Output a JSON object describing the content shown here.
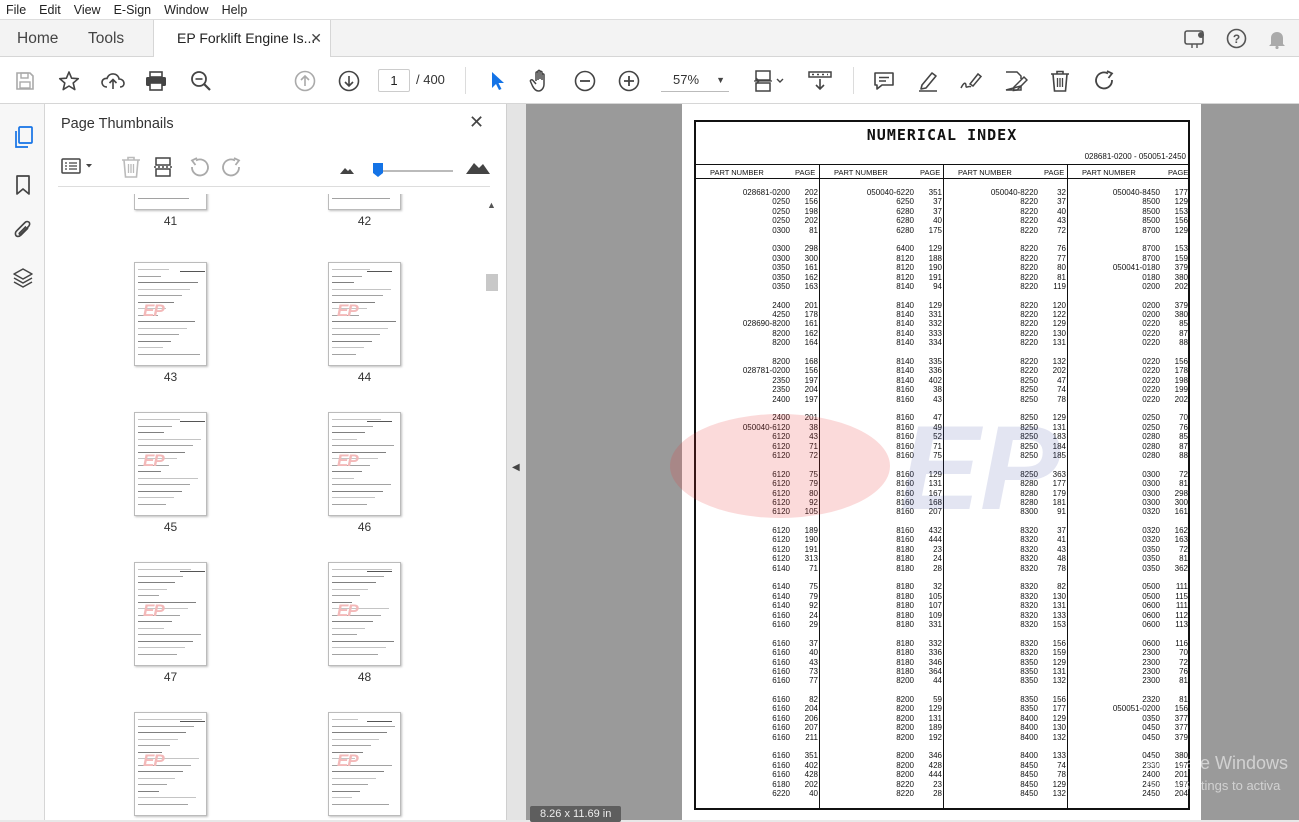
{
  "menu": [
    "File",
    "Edit",
    "View",
    "E-Sign",
    "Window",
    "Help"
  ],
  "tabs": {
    "home": "Home",
    "tools": "Tools",
    "document": "EP Forklift Engine Is..."
  },
  "toolbar": {
    "page_current": "1",
    "page_total": "/  400",
    "zoom": "57%"
  },
  "panel": {
    "title": "Page Thumbnails",
    "thumb_watermark": "EP",
    "thumbs": [
      "41",
      "42",
      "43",
      "44",
      "45",
      "46",
      "47",
      "48"
    ]
  },
  "page": {
    "title": "NUMERICAL  INDEX",
    "range": "028681-0200 - 050051-2450",
    "col_headers": {
      "part": "PART NUMBER",
      "page": "PAGE"
    },
    "col1": [
      [
        "028681-0200",
        "202"
      ],
      [
        "0250",
        "156"
      ],
      [
        "0250",
        "198"
      ],
      [
        "0250",
        "202"
      ],
      [
        "0300",
        "81"
      ],
      null,
      [
        "0300",
        "298"
      ],
      [
        "0300",
        "300"
      ],
      [
        "0350",
        "161"
      ],
      [
        "0350",
        "162"
      ],
      [
        "0350",
        "163"
      ],
      null,
      [
        "2400",
        "201"
      ],
      [
        "4250",
        "178"
      ],
      [
        "028690-8200",
        "161"
      ],
      [
        "8200",
        "162"
      ],
      [
        "8200",
        "164"
      ],
      null,
      [
        "8200",
        "168"
      ],
      [
        "028781-0200",
        "156"
      ],
      [
        "2350",
        "197"
      ],
      [
        "2350",
        "204"
      ],
      [
        "2400",
        "197"
      ],
      null,
      [
        "2400",
        "201"
      ],
      [
        "050040-6120",
        "38"
      ],
      [
        "6120",
        "43"
      ],
      [
        "6120",
        "71"
      ],
      [
        "6120",
        "72"
      ],
      null,
      [
        "6120",
        "75"
      ],
      [
        "6120",
        "79"
      ],
      [
        "6120",
        "80"
      ],
      [
        "6120",
        "92"
      ],
      [
        "6120",
        "105"
      ],
      null,
      [
        "6120",
        "189"
      ],
      [
        "6120",
        "190"
      ],
      [
        "6120",
        "191"
      ],
      [
        "6120",
        "313"
      ],
      [
        "6140",
        "71"
      ],
      null,
      [
        "6140",
        "75"
      ],
      [
        "6140",
        "79"
      ],
      [
        "6140",
        "92"
      ],
      [
        "6160",
        "24"
      ],
      [
        "6160",
        "29"
      ],
      null,
      [
        "6160",
        "37"
      ],
      [
        "6160",
        "40"
      ],
      [
        "6160",
        "43"
      ],
      [
        "6160",
        "73"
      ],
      [
        "6160",
        "77"
      ],
      null,
      [
        "6160",
        "82"
      ],
      [
        "6160",
        "204"
      ],
      [
        "6160",
        "206"
      ],
      [
        "6160",
        "207"
      ],
      [
        "6160",
        "211"
      ],
      null,
      [
        "6160",
        "351"
      ],
      [
        "6160",
        "402"
      ],
      [
        "6160",
        "428"
      ],
      [
        "6180",
        "202"
      ],
      [
        "6220",
        "40"
      ]
    ],
    "col2": [
      [
        "050040-6220",
        "351"
      ],
      [
        "6250",
        "37"
      ],
      [
        "6280",
        "37"
      ],
      [
        "6280",
        "40"
      ],
      [
        "6280",
        "175"
      ],
      null,
      [
        "6400",
        "129"
      ],
      [
        "8120",
        "188"
      ],
      [
        "8120",
        "190"
      ],
      [
        "8120",
        "191"
      ],
      [
        "8140",
        "94"
      ],
      null,
      [
        "8140",
        "129"
      ],
      [
        "8140",
        "331"
      ],
      [
        "8140",
        "332"
      ],
      [
        "8140",
        "333"
      ],
      [
        "8140",
        "334"
      ],
      null,
      [
        "8140",
        "335"
      ],
      [
        "8140",
        "336"
      ],
      [
        "8140",
        "402"
      ],
      [
        "8160",
        "38"
      ],
      [
        "8160",
        "43"
      ],
      null,
      [
        "8160",
        "47"
      ],
      [
        "8160",
        "49"
      ],
      [
        "8160",
        "52"
      ],
      [
        "8160",
        "71"
      ],
      [
        "8160",
        "75"
      ],
      null,
      [
        "8160",
        "129"
      ],
      [
        "8160",
        "131"
      ],
      [
        "8160",
        "167"
      ],
      [
        "8160",
        "168"
      ],
      [
        "8160",
        "207"
      ],
      null,
      [
        "8160",
        "432"
      ],
      [
        "8160",
        "444"
      ],
      [
        "8180",
        "23"
      ],
      [
        "8180",
        "24"
      ],
      [
        "8180",
        "28"
      ],
      null,
      [
        "8180",
        "32"
      ],
      [
        "8180",
        "105"
      ],
      [
        "8180",
        "107"
      ],
      [
        "8180",
        "109"
      ],
      [
        "8180",
        "331"
      ],
      null,
      [
        "8180",
        "332"
      ],
      [
        "8180",
        "336"
      ],
      [
        "8180",
        "346"
      ],
      [
        "8180",
        "364"
      ],
      [
        "8200",
        "44"
      ],
      null,
      [
        "8200",
        "59"
      ],
      [
        "8200",
        "129"
      ],
      [
        "8200",
        "131"
      ],
      [
        "8200",
        "189"
      ],
      [
        "8200",
        "192"
      ],
      null,
      [
        "8200",
        "346"
      ],
      [
        "8200",
        "428"
      ],
      [
        "8200",
        "444"
      ],
      [
        "8220",
        "23"
      ],
      [
        "8220",
        "28"
      ]
    ],
    "col3": [
      [
        "050040-8220",
        "32"
      ],
      [
        "8220",
        "37"
      ],
      [
        "8220",
        "40"
      ],
      [
        "8220",
        "43"
      ],
      [
        "8220",
        "72"
      ],
      null,
      [
        "8220",
        "76"
      ],
      [
        "8220",
        "77"
      ],
      [
        "8220",
        "80"
      ],
      [
        "8220",
        "81"
      ],
      [
        "8220",
        "119"
      ],
      null,
      [
        "8220",
        "120"
      ],
      [
        "8220",
        "122"
      ],
      [
        "8220",
        "129"
      ],
      [
        "8220",
        "130"
      ],
      [
        "8220",
        "131"
      ],
      null,
      [
        "8220",
        "132"
      ],
      [
        "8220",
        "202"
      ],
      [
        "8250",
        "47"
      ],
      [
        "8250",
        "74"
      ],
      [
        "8250",
        "78"
      ],
      null,
      [
        "8250",
        "129"
      ],
      [
        "8250",
        "131"
      ],
      [
        "8250",
        "183"
      ],
      [
        "8250",
        "184"
      ],
      [
        "8250",
        "185"
      ],
      null,
      [
        "8250",
        "363"
      ],
      [
        "8280",
        "177"
      ],
      [
        "8280",
        "179"
      ],
      [
        "8280",
        "181"
      ],
      [
        "8300",
        "91"
      ],
      null,
      [
        "8320",
        "37"
      ],
      [
        "8320",
        "41"
      ],
      [
        "8320",
        "43"
      ],
      [
        "8320",
        "48"
      ],
      [
        "8320",
        "78"
      ],
      null,
      [
        "8320",
        "82"
      ],
      [
        "8320",
        "130"
      ],
      [
        "8320",
        "131"
      ],
      [
        "8320",
        "133"
      ],
      [
        "8320",
        "153"
      ],
      null,
      [
        "8320",
        "156"
      ],
      [
        "8320",
        "159"
      ],
      [
        "8350",
        "129"
      ],
      [
        "8350",
        "131"
      ],
      [
        "8350",
        "132"
      ],
      null,
      [
        "8350",
        "156"
      ],
      [
        "8350",
        "177"
      ],
      [
        "8400",
        "129"
      ],
      [
        "8400",
        "130"
      ],
      [
        "8400",
        "132"
      ],
      null,
      [
        "8400",
        "133"
      ],
      [
        "8450",
        "74"
      ],
      [
        "8450",
        "78"
      ],
      [
        "8450",
        "129"
      ],
      [
        "8450",
        "132"
      ]
    ],
    "col4": [
      [
        "050040-8450",
        "177"
      ],
      [
        "8500",
        "129"
      ],
      [
        "8500",
        "153"
      ],
      [
        "8500",
        "156"
      ],
      [
        "8700",
        "129"
      ],
      null,
      [
        "8700",
        "153"
      ],
      [
        "8700",
        "159"
      ],
      [
        "050041-0180",
        "379"
      ],
      [
        "0180",
        "380"
      ],
      [
        "0200",
        "202"
      ],
      null,
      [
        "0200",
        "379"
      ],
      [
        "0200",
        "380"
      ],
      [
        "0220",
        "85"
      ],
      [
        "0220",
        "87"
      ],
      [
        "0220",
        "88"
      ],
      null,
      [
        "0220",
        "156"
      ],
      [
        "0220",
        "178"
      ],
      [
        "0220",
        "198"
      ],
      [
        "0220",
        "199"
      ],
      [
        "0220",
        "202"
      ],
      null,
      [
        "0250",
        "70"
      ],
      [
        "0250",
        "76"
      ],
      [
        "0280",
        "85"
      ],
      [
        "0280",
        "87"
      ],
      [
        "0280",
        "88"
      ],
      null,
      [
        "0300",
        "72"
      ],
      [
        "0300",
        "81"
      ],
      [
        "0300",
        "298"
      ],
      [
        "0300",
        "300"
      ],
      [
        "0320",
        "161"
      ],
      null,
      [
        "0320",
        "162"
      ],
      [
        "0320",
        "163"
      ],
      [
        "0350",
        "72"
      ],
      [
        "0350",
        "81"
      ],
      [
        "0350",
        "362"
      ],
      null,
      [
        "0500",
        "111"
      ],
      [
        "0500",
        "115"
      ],
      [
        "0600",
        "111"
      ],
      [
        "0600",
        "112"
      ],
      [
        "0600",
        "113"
      ],
      null,
      [
        "0600",
        "116"
      ],
      [
        "2300",
        "70"
      ],
      [
        "2300",
        "72"
      ],
      [
        "2300",
        "76"
      ],
      [
        "2300",
        "81"
      ],
      null,
      [
        "2320",
        "81"
      ],
      [
        "050051-0200",
        "156"
      ],
      [
        "0350",
        "377"
      ],
      [
        "0450",
        "377"
      ],
      [
        "0450",
        "379"
      ],
      null,
      [
        "0450",
        "380"
      ],
      [
        "2330",
        "197"
      ],
      [
        "2400",
        "201"
      ],
      [
        "2450",
        "197"
      ],
      [
        "2450",
        "204"
      ]
    ],
    "watermark": "EP"
  },
  "viewer": {
    "page_size": "8.26 x 11.69 in",
    "activate_line1": "Activate Windows",
    "activate_line2": "Go to Settings to activa"
  }
}
